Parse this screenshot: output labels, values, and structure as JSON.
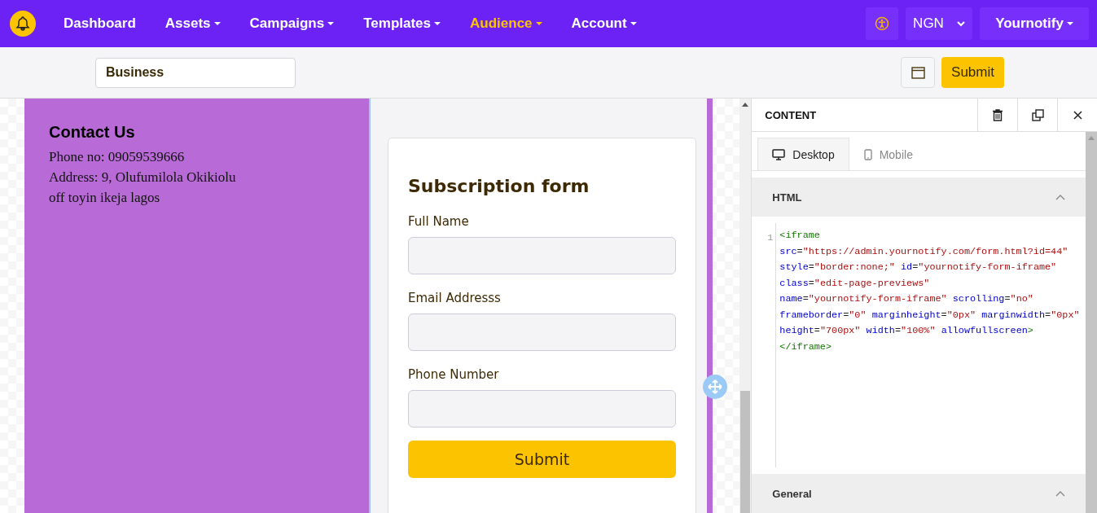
{
  "nav": {
    "items": [
      {
        "label": "Dashboard",
        "caret": false,
        "selected": false
      },
      {
        "label": "Assets",
        "caret": true,
        "selected": false
      },
      {
        "label": "Campaigns",
        "caret": true,
        "selected": false
      },
      {
        "label": "Templates",
        "caret": true,
        "selected": false
      },
      {
        "label": "Audience",
        "caret": true,
        "selected": true
      },
      {
        "label": "Account",
        "caret": true,
        "selected": false
      }
    ],
    "currency": "NGN",
    "account": "Yournotify"
  },
  "toolbar": {
    "page_name": "Business",
    "submit": "Submit"
  },
  "canvas": {
    "contact": {
      "title": "Contact Us",
      "lines": [
        "Phone no: 09059539666",
        "Address: 9, Olufumilola Okikiolu",
        "off toyin ikeja lagos"
      ]
    },
    "form": {
      "title": "Subscription form",
      "fields": [
        {
          "label": "Full Name"
        },
        {
          "label": "Email Addresss"
        },
        {
          "label": "Phone Number"
        }
      ],
      "submit": "Submit"
    }
  },
  "panel": {
    "title": "CONTENT",
    "tabs": [
      {
        "label": "Desktop",
        "kind": "desktop",
        "selected": true
      },
      {
        "label": "Mobile",
        "kind": "mobile",
        "selected": false
      }
    ],
    "sections": [
      {
        "title": "HTML",
        "expanded": true,
        "kind": "code"
      },
      {
        "title": "General",
        "expanded": true,
        "kind": "plain"
      }
    ],
    "code": {
      "line_number": "1",
      "tag": "<iframe",
      "attrs": [
        {
          "name": "src",
          "op": "=",
          "value": "\"https://admin.yournotify.com/form.html?id=44\""
        },
        {
          "name": "style",
          "op": "=",
          "value": "\"border:none;\""
        },
        {
          "name": "id",
          "op": "=",
          "value": "\"yournotify-form-iframe\""
        },
        {
          "name": "class",
          "op": "=",
          "value": "\"edit-page-previews\""
        },
        {
          "name": "name",
          "op": "=",
          "value": "\"yournotify-form-iframe\""
        },
        {
          "name": "scrolling",
          "op": "=",
          "value": "\"no\""
        },
        {
          "name": "frameborder",
          "op": "=",
          "value": "\"0\""
        },
        {
          "name": "marginheight",
          "op": "=",
          "value": "\"0px\""
        },
        {
          "name": "marginwidth",
          "op": "=",
          "value": "\"0px\""
        },
        {
          "name": "height",
          "op": "=",
          "value": "\"700px\""
        },
        {
          "name": "width",
          "op": "=",
          "value": "\"100%\""
        },
        {
          "name": "allowfullscreen"
        }
      ],
      "close": "></iframe>"
    }
  }
}
